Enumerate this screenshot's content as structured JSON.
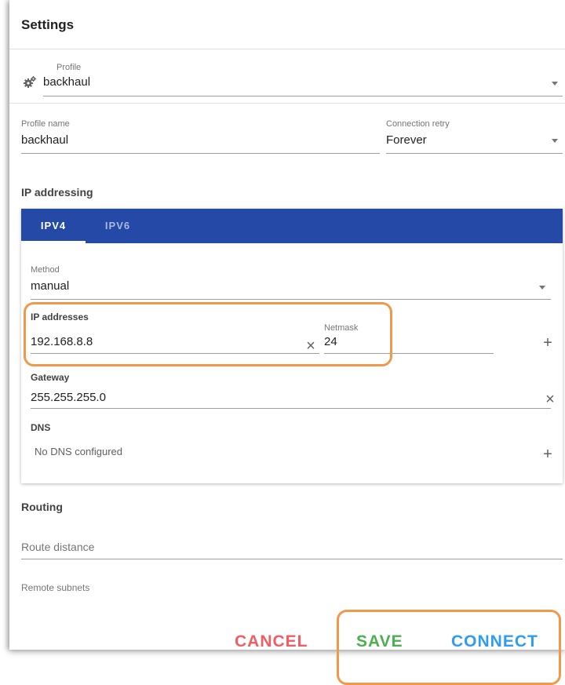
{
  "title": "Settings",
  "profile": {
    "label": "Profile",
    "value": "backhaul"
  },
  "profile_name": {
    "label": "Profile name",
    "value": "backhaul"
  },
  "connection_retry": {
    "label": "Connection retry",
    "value": "Forever"
  },
  "ip_addressing": {
    "title": "IP addressing",
    "tabs": [
      {
        "label": "IPV4",
        "active": true
      },
      {
        "label": "IPV6",
        "active": false
      }
    ],
    "method": {
      "label": "Method",
      "value": "manual"
    },
    "ip_addresses": {
      "label": "IP addresses",
      "value": "192.168.8.8",
      "netmask_label": "Netmask",
      "netmask_value": "24"
    },
    "gateway": {
      "label": "Gateway",
      "value": "255.255.255.0"
    },
    "dns": {
      "label": "DNS",
      "empty_text": "No DNS configured"
    }
  },
  "routing": {
    "title": "Routing",
    "route_distance_placeholder": "Route distance",
    "remote_subnets_label": "Remote subnets"
  },
  "actions": {
    "cancel": "CANCEL",
    "save": "SAVE",
    "connect": "CONNECT"
  },
  "colors": {
    "tab_bar": "#2549a6",
    "cancel": "#f25c63",
    "save": "#4caf50",
    "connect": "#2e9cf0",
    "highlight": "#f0994a"
  },
  "icons": {
    "profile": "gears-icon",
    "dropdown": "caret-down-icon",
    "clear": "close-icon",
    "add": "plus-icon"
  }
}
